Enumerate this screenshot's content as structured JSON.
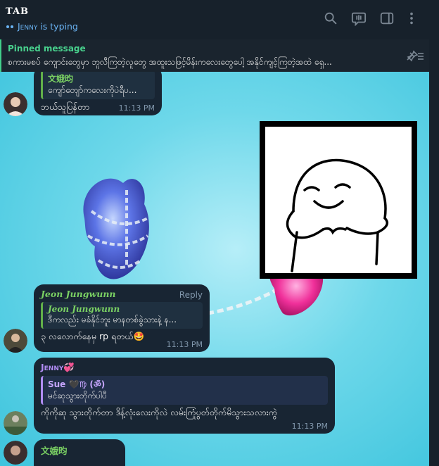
{
  "header": {
    "title": "TAB",
    "typing_name": "Jenny",
    "typing_suffix": " is typing"
  },
  "pinned": {
    "label": "Pinned message",
    "text": "စကားမစပ် ကျောင်းတွေမှာ ဘူလီကြတဲ့လူတွေ အထူးသဖြင့်မိန်းကလေးတွေပေါ့ အနိုင်ကျင့်ကြတဲ့အထဲ ရှေ..."
  },
  "messages": [
    {
      "reply_name": "文娥昀",
      "reply_text": "ကျော်တျော်ကလေးကိုပဲရီပ...",
      "text": "ဘယ်သူပြန်တာ",
      "time": "11:13 PM"
    },
    {
      "sender": "Jeon Jungwunn",
      "reply_link": "Reply",
      "reply_name": "Jeon Jungwunn",
      "reply_text": "ဒီကလည်း မခံနိုင်ဘူး မာနတစ်ခွဲသားနဲ့ န...",
      "text": "၃ လလောက်နေမှ rp ရတယ်🤩",
      "time": "11:13 PM"
    },
    {
      "sender": "Jenny",
      "sender_emoji": "💞",
      "reply_name": "Sue",
      "reply_name_suffix": " 🖤♍ (ॐ)",
      "reply_text": "မင်ဆုသွားတိုက်ပါပီ",
      "text": "ကိုကိုဆု သွားတိုက်တာ ဒိန့်လုံးလေးကိုလဲ လမ်းကြုံပွတ်တိုက်မိသွားသလားကွဲ",
      "time": "11:13 PM"
    },
    {
      "sender": "文娥昀"
    }
  ],
  "colors": {
    "accent": "#6ab3f3",
    "pinned_green": "#48d18d",
    "bubble": "#182533",
    "reply_green": "#62b04a",
    "sender_green": "#7ad063",
    "jenny_purple": "#b18df5"
  },
  "icons": [
    "search-icon",
    "voice-chat-icon",
    "sidebar-toggle-icon",
    "more-vert-icon",
    "unpin-icon"
  ]
}
